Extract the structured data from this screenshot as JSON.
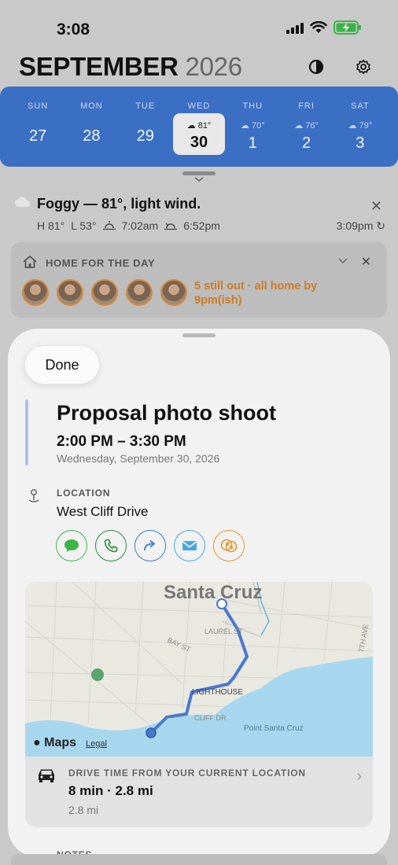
{
  "status": {
    "time": "3:08"
  },
  "header": {
    "month": "SEPTEMBER",
    "year": "2026"
  },
  "week": [
    {
      "name": "SUN",
      "date": "27",
      "weather": ""
    },
    {
      "name": "MON",
      "date": "28",
      "weather": ""
    },
    {
      "name": "TUE",
      "date": "29",
      "weather": ""
    },
    {
      "name": "WED",
      "date": "30",
      "weather": "81°",
      "selected": true
    },
    {
      "name": "THU",
      "date": "1",
      "weather": "70°"
    },
    {
      "name": "FRI",
      "date": "2",
      "weather": "76°"
    },
    {
      "name": "SAT",
      "date": "3",
      "weather": "79°"
    }
  ],
  "weather": {
    "summary": "Foggy — 81°, light wind.",
    "high": "H 81°",
    "low": "L 53°",
    "sunrise": "7:02am",
    "sunset": "6:52pm",
    "updated": "3:09pm"
  },
  "home": {
    "title": "HOME FOR THE DAY",
    "note": "5 still out · all home by 9pm(ish)",
    "avatar_count": 5
  },
  "sheet": {
    "done_label": "Done",
    "event_title": "Proposal photo shoot",
    "event_time": "2:00 PM – 3:30 PM",
    "event_date": "Wednesday, September 30, 2026",
    "location_label": "LOCATION",
    "location_value": "West Cliff Drive",
    "actions": [
      {
        "name": "message",
        "color": "#3bb54a"
      },
      {
        "name": "call",
        "color": "#2a8a3e"
      },
      {
        "name": "share",
        "color": "#3a7bd5"
      },
      {
        "name": "mail",
        "color": "#4aa8e0"
      },
      {
        "name": "people",
        "color": "#e8962a"
      }
    ],
    "map": {
      "title": "Santa Cruz",
      "labels": [
        "LAUREL ST",
        "BAY ST",
        "LIGHTHOUSE",
        "CLIFF DR",
        "Point Santa Cruz",
        "7TH AVE"
      ],
      "logo": "Maps",
      "legal": "Legal",
      "route_color": "#4a78d0",
      "water_color": "#a7d7ee"
    },
    "drive": {
      "label": "DRIVE TIME FROM YOUR CURRENT LOCATION",
      "value": "8 min · 2.8 mi",
      "sub": "2.8 mi"
    },
    "notes_label": "NOTES"
  }
}
